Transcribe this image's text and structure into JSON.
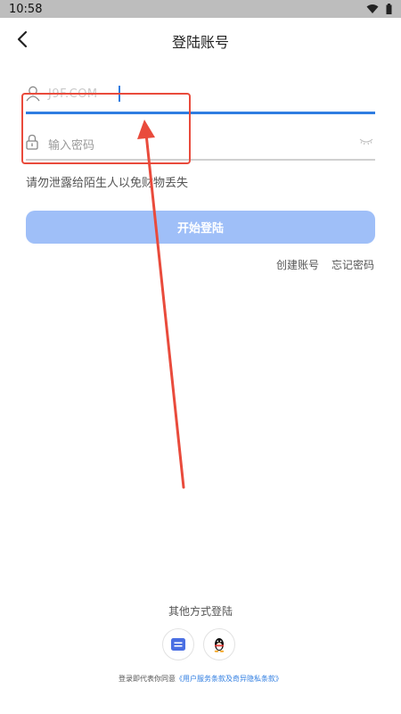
{
  "status": {
    "time": "10:58",
    "icons": [
      "wifi-icon",
      "battery-icon"
    ]
  },
  "header": {
    "title": "登陆账号",
    "back_icon": "chevron-left-icon"
  },
  "form": {
    "username": {
      "value": "J9F.COM",
      "icon": "user-icon"
    },
    "password": {
      "placeholder": "输入密码",
      "icon": "lock-icon",
      "toggle_icon": "eye-closed-icon"
    },
    "warning": "请勿泄露给陌生人以免财物丢失",
    "submit_label": "开始登陆"
  },
  "links": {
    "create": "创建账号",
    "forgot": "忘记密码"
  },
  "other_login": {
    "title": "其他方式登陆",
    "methods": [
      {
        "name": "message",
        "icon": "message-icon"
      },
      {
        "name": "qq",
        "icon": "qq-penguin-icon"
      }
    ]
  },
  "agreement": {
    "prefix": "登录即代表你同意",
    "terms": "《用户服务条款及奇异隐私条款》"
  },
  "colors": {
    "accent": "#2f7de1",
    "button": "#9fbff8",
    "annotation": "#e94b3c",
    "statusbar": "#bdbdbd"
  }
}
